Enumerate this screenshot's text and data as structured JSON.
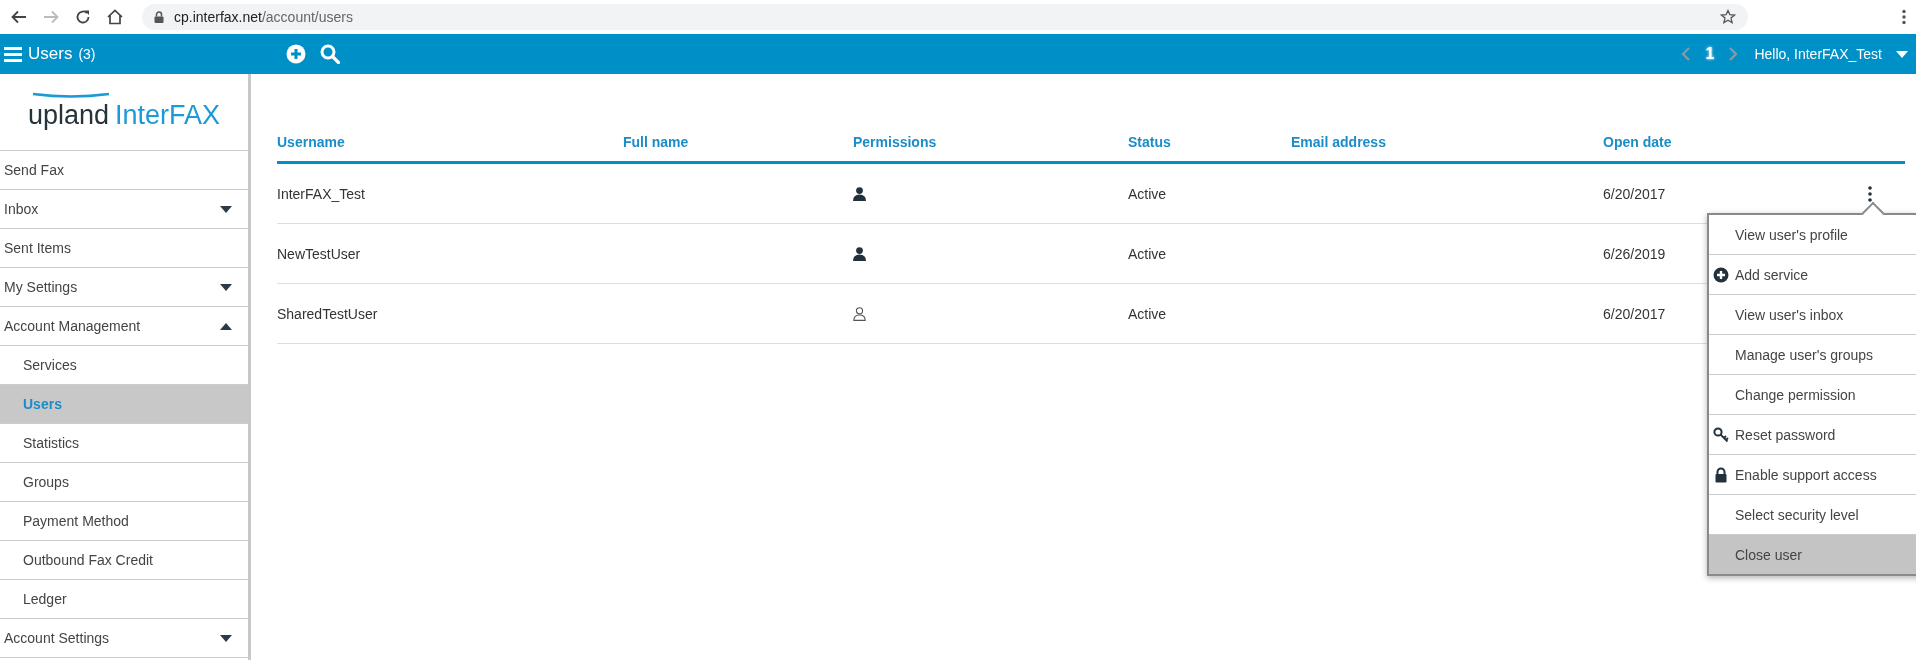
{
  "browser": {
    "url_host": "cp.interfax.net",
    "url_path": "/account/users",
    "forward_disabled": true
  },
  "header": {
    "title": "Users",
    "count": "(3)",
    "page": "1",
    "prev_disabled": true,
    "next_disabled": true,
    "greeting": "Hello, InterFAX_Test"
  },
  "logo": {
    "brand": "upland",
    "product": "InterFAX"
  },
  "sidebar": {
    "items": [
      {
        "label": "Send Fax",
        "selected": false
      },
      {
        "label": "Inbox",
        "selected": false,
        "expanded": false
      },
      {
        "label": "Sent Items",
        "selected": false
      },
      {
        "label": "My Settings",
        "selected": false,
        "expanded": false
      },
      {
        "label": "Account Management",
        "selected": false,
        "expanded": true,
        "children": [
          {
            "label": "Services",
            "selected": false
          },
          {
            "label": "Users",
            "selected": true
          },
          {
            "label": "Statistics",
            "selected": false
          },
          {
            "label": "Groups",
            "selected": false
          },
          {
            "label": "Payment Method",
            "selected": false
          },
          {
            "label": "Outbound Fax Credit",
            "selected": false
          },
          {
            "label": "Ledger",
            "selected": false
          }
        ]
      },
      {
        "label": "Account Settings",
        "selected": false,
        "expanded": false
      }
    ]
  },
  "table": {
    "columns": [
      "Username",
      "Full name",
      "Permissions",
      "Status",
      "Email address",
      "Open date"
    ],
    "rows": [
      {
        "username": "InterFAX_Test",
        "kind": "filled",
        "status": "Active",
        "open_date": "6/20/2017"
      },
      {
        "username": "NewTestUser",
        "kind": "filled",
        "status": "Active",
        "open_date": "6/26/2019"
      },
      {
        "username": "SharedTestUser",
        "kind": "outline",
        "status": "Active",
        "open_date": "6/20/2017"
      }
    ]
  },
  "row_menu": {
    "items": [
      {
        "label": "View user's profile",
        "kind": "plain",
        "highlighted": false
      },
      {
        "label": "Add service",
        "kind": "add",
        "highlighted": false
      },
      {
        "label": "View user's inbox",
        "kind": "plain",
        "highlighted": false
      },
      {
        "label": "Manage user's groups",
        "kind": "plain",
        "highlighted": false
      },
      {
        "label": "Change permission",
        "kind": "plain",
        "highlighted": false
      },
      {
        "label": "Reset password",
        "kind": "key",
        "highlighted": false
      },
      {
        "label": "Enable support access",
        "kind": "lock",
        "highlighted": false
      },
      {
        "label": "Select security level",
        "kind": "plain",
        "highlighted": false
      },
      {
        "label": "Close user",
        "kind": "plain",
        "highlighted": true
      }
    ]
  }
}
